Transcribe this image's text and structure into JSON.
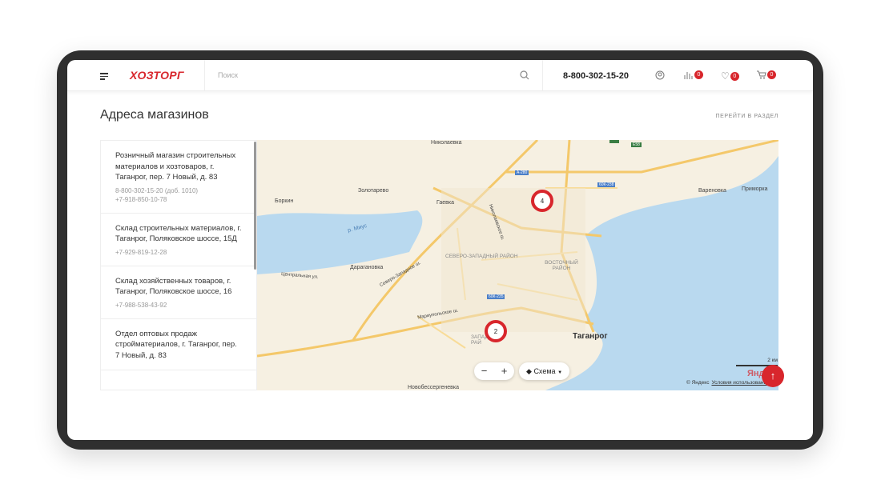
{
  "header": {
    "logo": "ХОЗТОРГ",
    "search_placeholder": "Поиск",
    "phone": "8-800-302-15-20",
    "compare_count": "0",
    "favorites_count": "0",
    "cart_count": "0"
  },
  "page": {
    "title": "Адреса магазинов",
    "goto_section": "ПЕРЕЙТИ В РАЗДЕЛ"
  },
  "stores": [
    {
      "name": "Розничный магазин строительных материалов и хозтоваров, г. Таганрог, пер. 7 Новый, д. 83",
      "phones": [
        "8-800-302-15-20 (доб. 1010)",
        "+7-918-850-10-78"
      ]
    },
    {
      "name": "Склад строительных материалов, г. Таганрог, Поляковское шоссе, 15Д",
      "phones": [
        "+7-929-819-12-28"
      ]
    },
    {
      "name": "Склад хозяйственных товаров, г. Таганрог, Поляковское шоссе, 16",
      "phones": [
        "+7-988-538-43-92"
      ]
    },
    {
      "name": "Отдел оптовых продаж стройматериалов, г. Таганрог, пер. 7 Новый, д. 83",
      "phones": []
    }
  ],
  "map": {
    "labels": {
      "nikolaevka": "Николаевка",
      "zolotarevo": "Золотарево",
      "borkin": "Боркин",
      "gaevka": "Гаевка",
      "varenovka": "Вареновка",
      "primorka": "Приморка",
      "daraganovka": "Дарагановка",
      "mius": "р. Миус",
      "sz": "СЕВЕРО-ЗАПАДНЫЙ РАЙОН",
      "vost": "ВОСТОЧНЫЙ РАЙОН",
      "taganrog": "Таганрог",
      "nikolaevskoe": "Николаевское ш.",
      "markupolskoe": "Мариупольское ш.",
      "szsh": "Северо-Западное ш.",
      "novobessergenevka": "Новобессергеневка",
      "central": "Центральная ул.",
      "zapad": "ЗАПАД РАЙ",
      "e58": "E58",
      "a280": "А-280",
      "k238": "60К-238",
      "k235": "60К-235"
    },
    "clusters": [
      "4",
      "2"
    ],
    "zoom_out": "−",
    "zoom_in": "+",
    "layer": "Схема",
    "scale": "2 км",
    "yandex": "Янд",
    "copyright": "© Яндекс",
    "terms": "Условия использования"
  },
  "scroll_top": "↑"
}
